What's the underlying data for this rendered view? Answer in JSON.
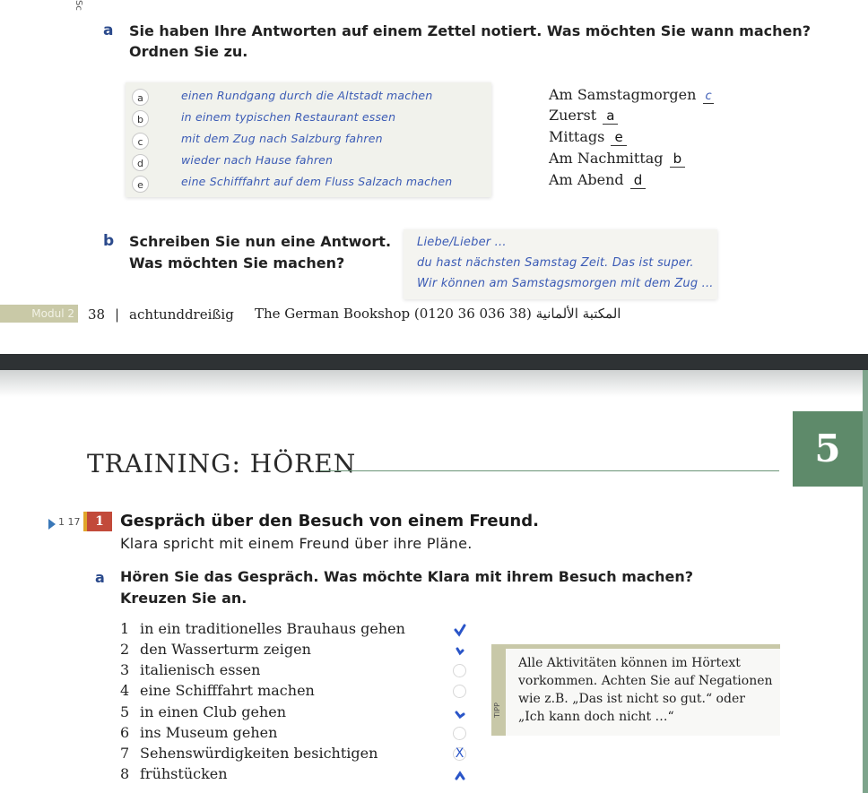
{
  "top_page": {
    "side_label": "Sc",
    "exercise_a": {
      "letter": "a",
      "line1": "Sie haben Ihre Antworten auf einem Zettel notiert. Was möchten Sie wann machen?",
      "line2": "Ordnen Sie zu."
    },
    "activities": [
      {
        "key": "a",
        "text": "einen Rundgang durch die Altstadt machen"
      },
      {
        "key": "b",
        "text": "in einem typischen Restaurant essen"
      },
      {
        "key": "c",
        "text": "mit dem Zug nach Salzburg fahren"
      },
      {
        "key": "d",
        "text": "wieder nach Hause fahren"
      },
      {
        "key": "e",
        "text": "eine Schifffahrt auf dem Fluss Salzach machen"
      }
    ],
    "times": [
      {
        "label": "Am Samstagmorgen",
        "answer": "c"
      },
      {
        "label": "Zuerst",
        "answer": "a"
      },
      {
        "label": "Mittags",
        "answer": "e"
      },
      {
        "label": "Am Nachmittag",
        "answer": "b"
      },
      {
        "label": "Am Abend",
        "answer": "d"
      }
    ],
    "exercise_b": {
      "letter": "b",
      "line1": "Schreiben Sie nun eine Antwort.",
      "line2": "Was möchten Sie machen?"
    },
    "letter_note": {
      "line1": "Liebe/Lieber ...",
      "line2": "du hast nächsten Samstag Zeit. Das ist super.",
      "line3": "Wir können am Samstagsmorgen mit dem Zug ..."
    },
    "footer": {
      "modul": "Modul 2",
      "page_number": "38",
      "separator": "|",
      "page_word": "achtunddreißig",
      "stamp": "The German Bookshop (0120 36 036 38) المكتبة الألمانية"
    }
  },
  "bottom_page": {
    "chapter_number": "5",
    "section_title": "TRAINING: HÖREN",
    "audio_track": "1 17",
    "exercise_number": "1",
    "exercise_title": "Gespräch über den Besuch von einem Freund.",
    "exercise_subtitle": "Klara spricht mit einem Freund über ihre Pläne.",
    "task_letter": "a",
    "task_line1": "Hören Sie das Gespräch. Was möchte Klara mit ihrem Besuch machen?",
    "task_line2": "Kreuzen Sie an.",
    "items": [
      {
        "num": "1",
        "text": "in ein traditionelles Brauhaus gehen",
        "mark": "ticked"
      },
      {
        "num": "2",
        "text": "den Wasserturm zeigen",
        "mark": "ticked"
      },
      {
        "num": "3",
        "text": "italienisch essen",
        "mark": "empty"
      },
      {
        "num": "4",
        "text": "eine Schifffahrt machen",
        "mark": "empty"
      },
      {
        "num": "5",
        "text": "in einen Club gehen",
        "mark": "ticked"
      },
      {
        "num": "6",
        "text": "ins Museum gehen",
        "mark": "empty"
      },
      {
        "num": "7",
        "text": "Sehenswürdigkeiten besichtigen",
        "mark": "X"
      },
      {
        "num": "8",
        "text": "frühstücken",
        "mark": "ticked"
      }
    ],
    "cross_mark": "X",
    "tipp": {
      "label": "TIPP",
      "line1": "Alle Aktivitäten können im Hörtext",
      "line2": "vorkommen. Achten Sie auf Negationen",
      "line3": "wie z.B. „Das ist nicht so gut.“ oder",
      "line4": "„Ich kann doch nicht …“"
    }
  },
  "colors": {
    "accent_green": "#5e8a6a",
    "handwriting_blue": "#3b5bb5",
    "exercise_red": "#c24a3a",
    "dark_band": "#2e3234"
  }
}
